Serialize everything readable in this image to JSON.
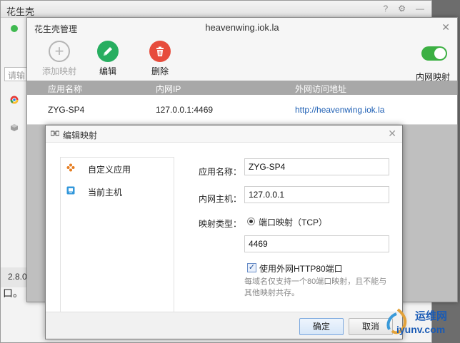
{
  "background_window": {
    "title": "花生壳",
    "icons": [
      "help-icon",
      "gear-icon",
      "minimize-icon"
    ],
    "help_glyph": "?",
    "gear_glyph": "⚙",
    "minimize_glyph": "—",
    "search_placeholder": "请输",
    "version_text": "2.8.0",
    "edge_text": "口。"
  },
  "manager": {
    "app_title": "花生壳管理",
    "domain_title": "heavenwing.iok.la",
    "close_glyph": "✕",
    "toolbar": {
      "add_label": "添加映射",
      "edit_label": "编辑",
      "delete_label": "删除",
      "toggle_label": "内网映射",
      "toggle_on": true
    },
    "table": {
      "headers": [
        "应用名称",
        "内网IP",
        "外网访问地址"
      ],
      "rows": [
        {
          "name": "ZYG-SP4",
          "ip": "127.0.0.1:4469",
          "url": "http://heavenwing.iok.la"
        }
      ]
    }
  },
  "dialog": {
    "title": "编辑映射",
    "close_glyph": "✕",
    "side_items": [
      {
        "label": "自定义应用",
        "icon": "puzzle-icon"
      },
      {
        "label": "当前主机",
        "icon": "monitor-icon"
      }
    ],
    "form": {
      "app_name_label": "应用名称：",
      "app_name_value": "ZYG-SP4",
      "host_label": "内网主机：",
      "host_value": "127.0.0.1",
      "type_label": "映射类型：",
      "type_option": "端口映射（TCP）",
      "port_value": "4469",
      "checkbox_label": "使用外网HTTP80端口",
      "checkbox_checked": true,
      "checkbox_glyph": "✓",
      "hint": "每域名仅支持一个80端口映射，且不能与其他映射共存。"
    },
    "ok_label": "确定",
    "cancel_label": "取消"
  },
  "watermark": {
    "line1": "运维网",
    "line2": "iyunv.com"
  },
  "colors": {
    "accent_green": "#27ae60",
    "delete_red": "#e74c3c",
    "link_blue": "#1e5fb4",
    "header_gray": "#a8a8a8"
  }
}
